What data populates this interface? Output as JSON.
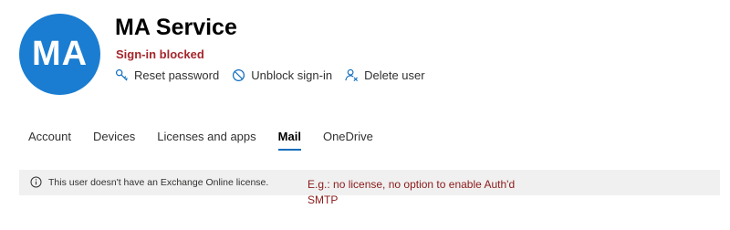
{
  "user": {
    "initials": "MA",
    "name": "MA Service",
    "status": "Sign-in blocked"
  },
  "actions": [
    {
      "label": "Reset password",
      "icon": "key-icon"
    },
    {
      "label": "Unblock sign-in",
      "icon": "block-icon"
    },
    {
      "label": "Delete user",
      "icon": "delete-user-icon"
    }
  ],
  "tabs": [
    {
      "label": "Account",
      "active": false
    },
    {
      "label": "Devices",
      "active": false
    },
    {
      "label": "Licenses and apps",
      "active": false
    },
    {
      "label": "Mail",
      "active": true
    },
    {
      "label": "OneDrive",
      "active": false
    }
  ],
  "banner": {
    "icon": "info-icon",
    "text": "This user doesn't have an Exchange Online license."
  },
  "annotation": {
    "text": "E.g.: no license, no option to enable Auth'd SMTP"
  },
  "colors": {
    "avatar": "#1a7dd1",
    "status": "#a4262c",
    "annotation": "#8b1a1a",
    "banner_bg": "#f0f0f0",
    "icon_blue": "#0f6cbd"
  }
}
